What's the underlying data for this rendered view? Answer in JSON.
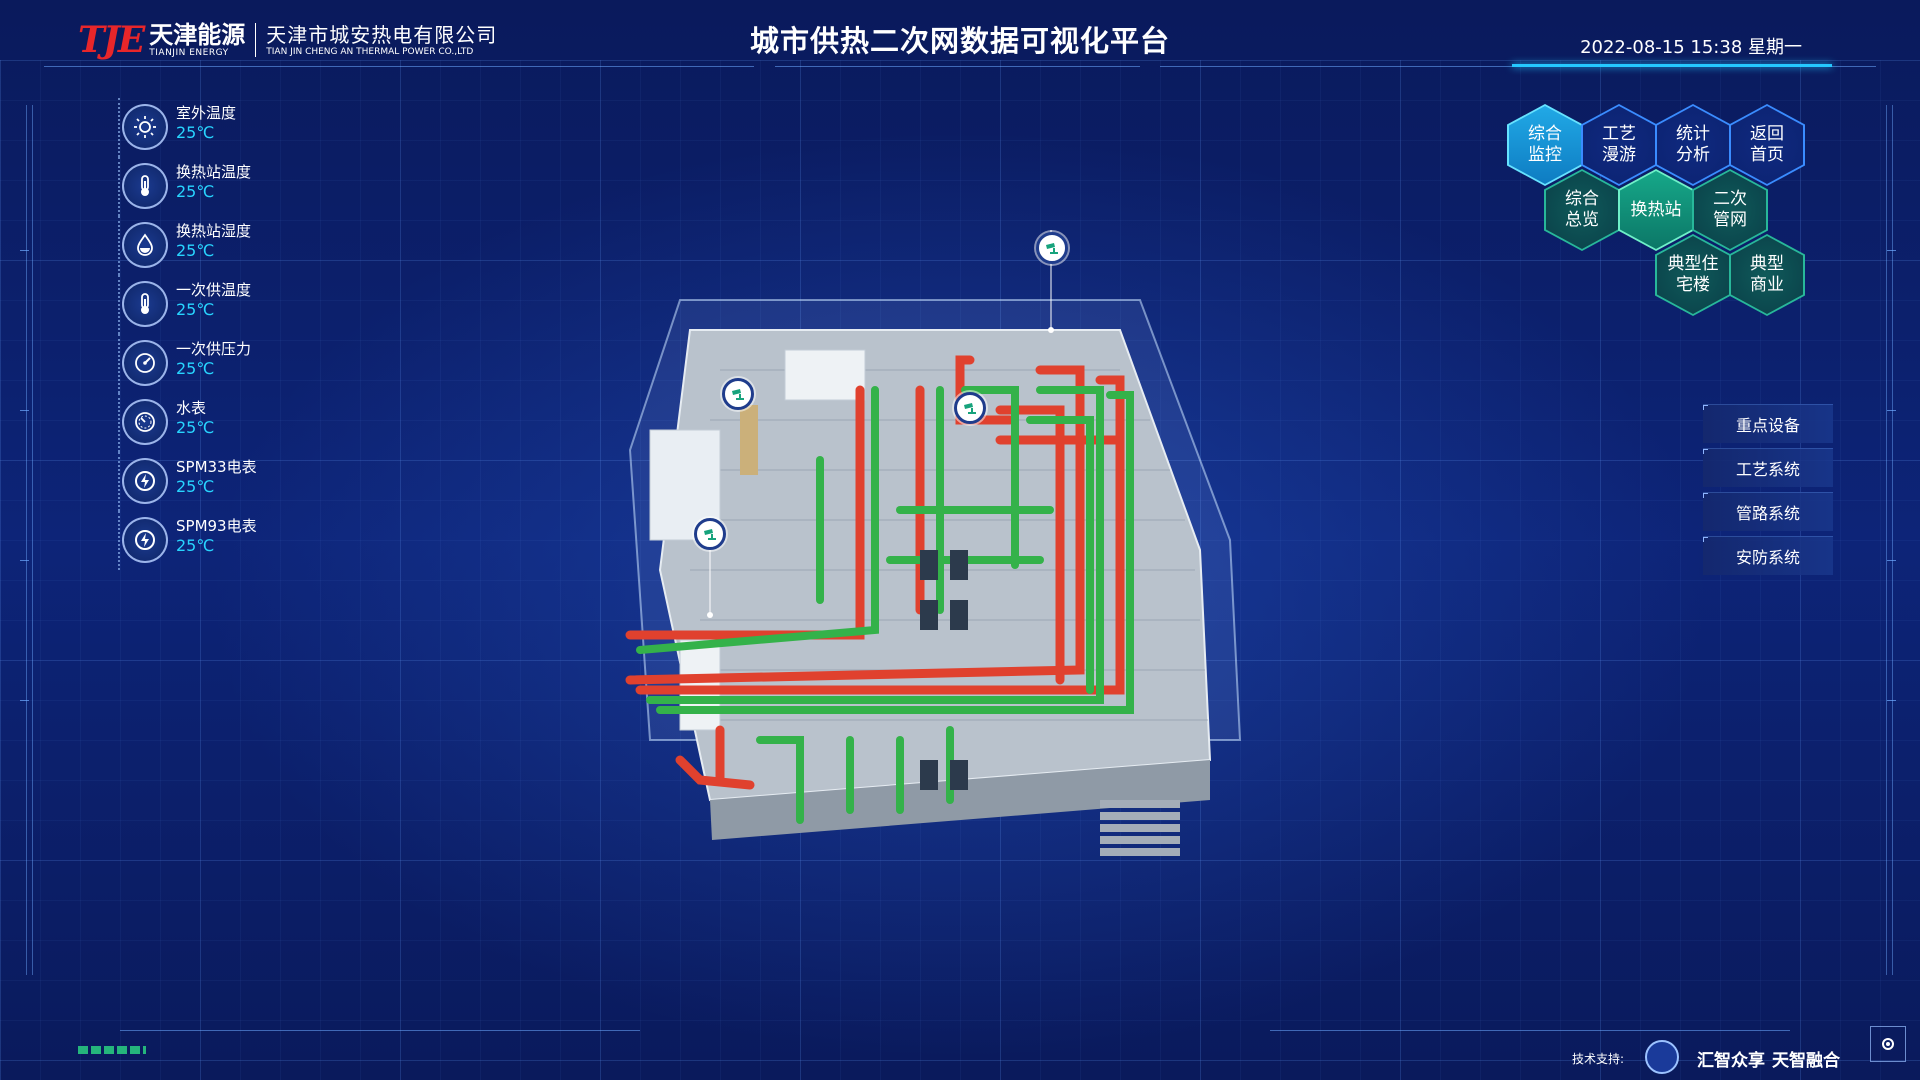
{
  "header": {
    "logo_mark": "TJE",
    "logo_cn": "天津能源",
    "logo_en": "TIANJIN ENERGY",
    "company_cn": "天津市城安热电有限公司",
    "company_en": "TIAN JIN CHENG AN THERMAL POWER CO.,LTD",
    "title": "城市供热二次网数据可视化平台",
    "datetime": "2022-08-15 15:38 星期一"
  },
  "metrics": [
    {
      "label": "室外温度",
      "value": "25℃",
      "icon": "sun-icon"
    },
    {
      "label": "换热站温度",
      "value": "25℃",
      "icon": "thermometer-icon"
    },
    {
      "label": "换热站湿度",
      "value": "25℃",
      "icon": "droplet-icon"
    },
    {
      "label": "一次供温度",
      "value": "25℃",
      "icon": "thermometer-icon"
    },
    {
      "label": "一次供压力",
      "value": "25℃",
      "icon": "gauge-icon"
    },
    {
      "label": "水表",
      "value": "25℃",
      "icon": "meter-icon"
    },
    {
      "label": "SPM33电表",
      "value": "25℃",
      "icon": "power-icon"
    },
    {
      "label": "SPM93电表",
      "value": "25℃",
      "icon": "power-icon"
    }
  ],
  "nav": {
    "hex_items": [
      {
        "label": "综合监控",
        "state": "active"
      },
      {
        "label": "工艺漫游",
        "state": "normal"
      },
      {
        "label": "统计分析",
        "state": "normal"
      },
      {
        "label": "返回首页",
        "state": "normal"
      },
      {
        "label": "综合总览",
        "state": "normal"
      },
      {
        "label": "换热站",
        "state": "active"
      },
      {
        "label": "二次管网",
        "state": "normal"
      },
      {
        "label": "典型住宅楼",
        "state": "normal"
      },
      {
        "label": "典型商业",
        "state": "normal"
      }
    ]
  },
  "systems": {
    "buttons": [
      "重点设备",
      "工艺系统",
      "管路系统",
      "安防系统"
    ]
  },
  "footer": {
    "support_label": "技术支持:",
    "partner_1": "汇智众享",
    "partner_2": "天智融合"
  },
  "colors": {
    "background": "#0b1f66",
    "accent_cyan": "#28d5ff",
    "pipe_red": "#e0412e",
    "pipe_green": "#34b24a",
    "hex_blue": "#3a8cff",
    "hex_green": "#28b79a"
  }
}
